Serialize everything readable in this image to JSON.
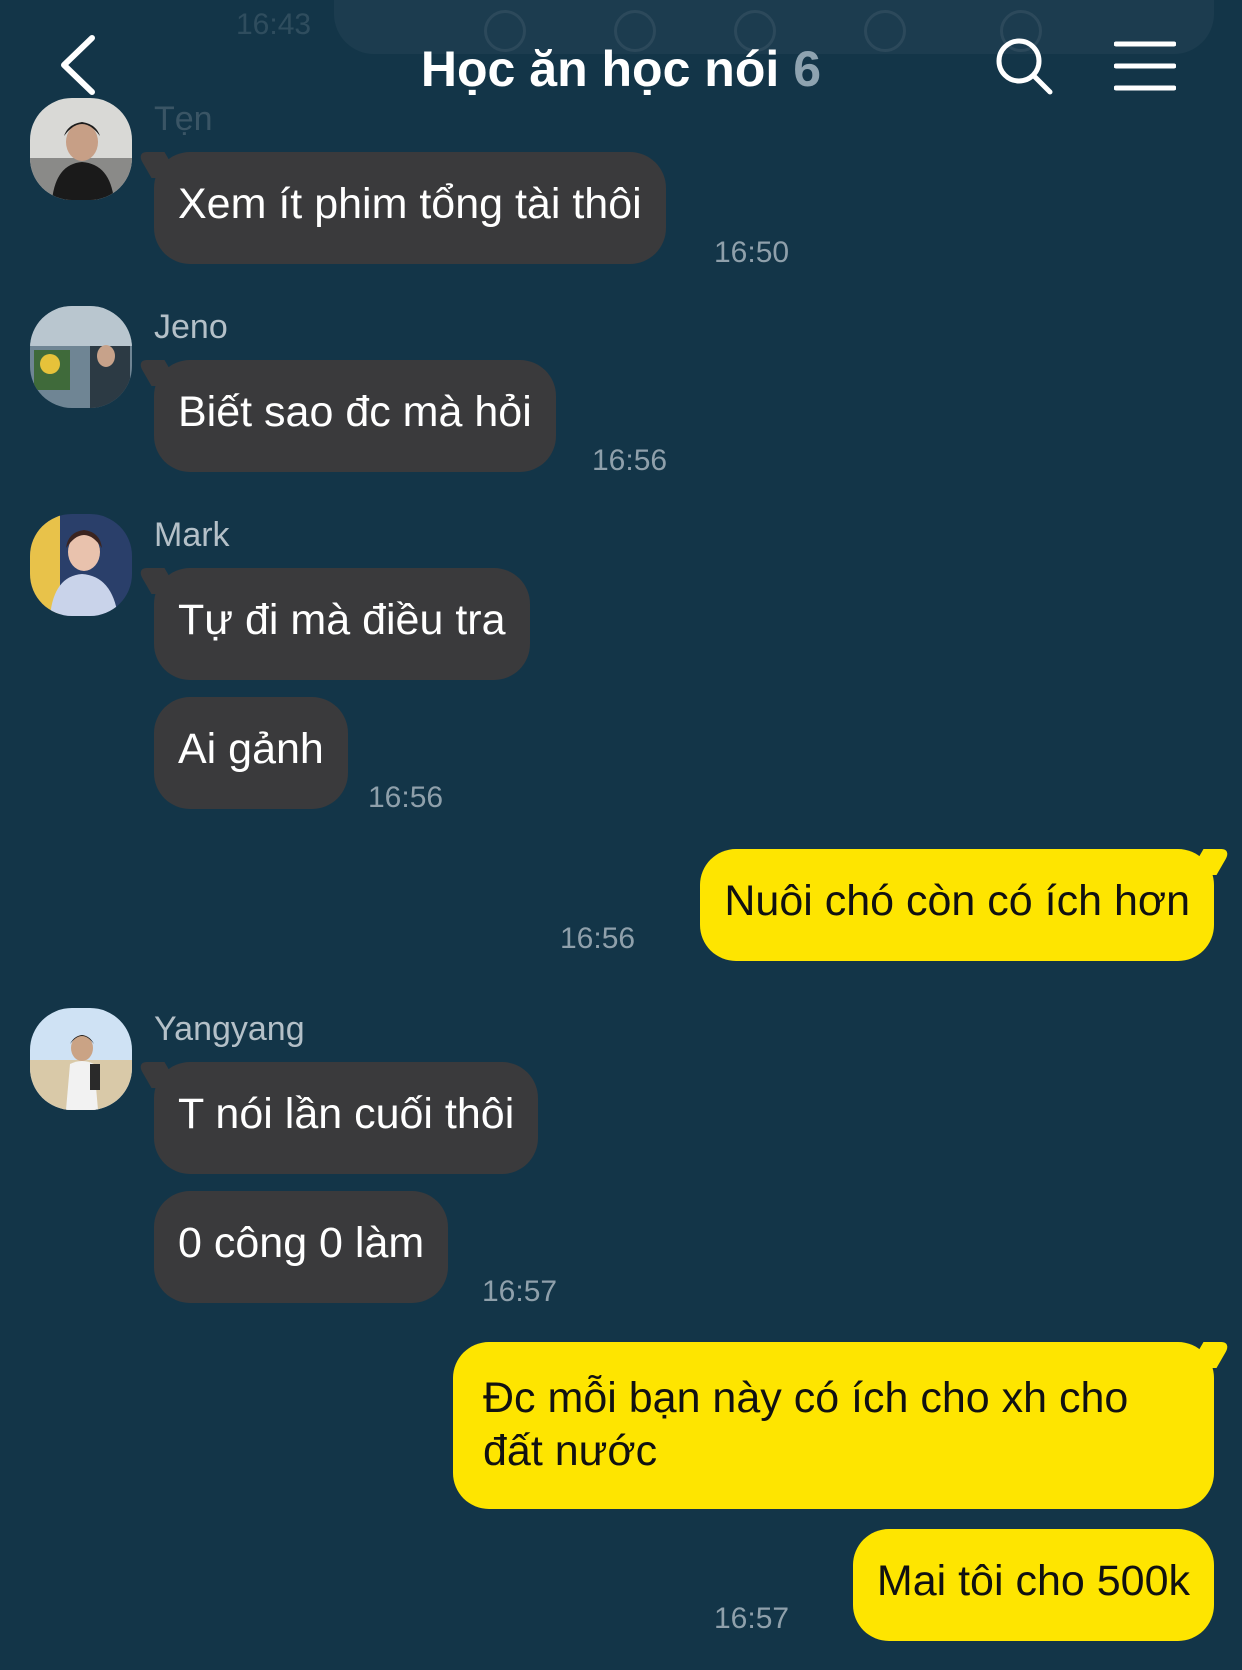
{
  "header": {
    "title": "Học ăn học nói",
    "member_count": "6",
    "icons": {
      "back": "chevron-left-icon",
      "search": "search-icon",
      "menu": "hamburger-menu-icon"
    }
  },
  "top_overlay": {
    "time": "16:43"
  },
  "messages": [
    {
      "sender": "Tẹn",
      "text": "Xem ít phim tổng tài thôi",
      "time": "16:50",
      "direction": "incoming"
    },
    {
      "sender": "Jeno",
      "text": "Biết sao đc mà hỏi",
      "time": "16:56",
      "direction": "incoming"
    },
    {
      "sender": "Mark",
      "text": "Tự đi mà điều tra",
      "direction": "incoming"
    },
    {
      "text": "Ai gảnh",
      "time": "16:56",
      "direction": "incoming"
    },
    {
      "text": "Nuôi chó còn có ích hơn",
      "time": "16:56",
      "direction": "outgoing"
    },
    {
      "sender": "Yangyang",
      "text": "T nói lần cuối thôi",
      "direction": "incoming"
    },
    {
      "text": "0 công 0 làm",
      "time": "16:57",
      "direction": "incoming"
    },
    {
      "text": "Đc mỗi bạn này có ích cho xh cho đất nước",
      "direction": "outgoing"
    },
    {
      "text": "Mai tôi cho 500k",
      "time": "16:57",
      "direction": "outgoing"
    }
  ],
  "colors": {
    "background": "#133548",
    "incoming_bubble": "#3a3a3c",
    "outgoing_bubble": "#fee500",
    "timestamp": "#8fa0ab",
    "sender_name": "#b4c0c8"
  }
}
